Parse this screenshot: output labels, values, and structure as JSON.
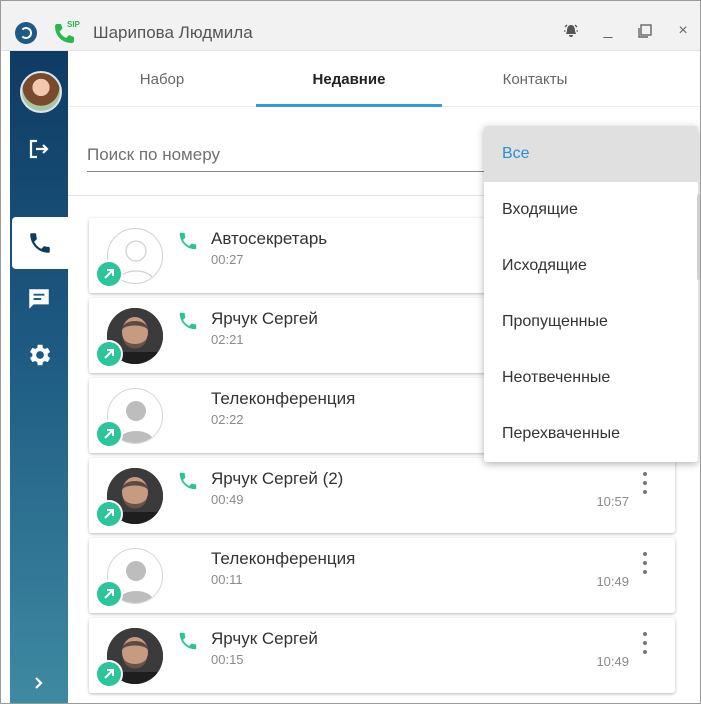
{
  "window": {
    "title": "Шарипова Людмила",
    "sip_label": "SIP",
    "buttons": {
      "minimize": "_",
      "close": "×"
    }
  },
  "sidebar": {
    "items": [
      {
        "icon": "avatar"
      },
      {
        "icon": "logout-icon"
      },
      {
        "icon": "phone-icon",
        "active": true
      },
      {
        "icon": "chat-icon"
      },
      {
        "icon": "gear-icon"
      },
      {
        "icon": "chevron-right-icon"
      }
    ]
  },
  "tabs": [
    {
      "label": "Набор"
    },
    {
      "label": "Недавние",
      "active": true
    },
    {
      "label": "Контакты"
    }
  ],
  "search": {
    "placeholder": "Поиск по номеру",
    "value": ""
  },
  "calls": [
    {
      "name": "Автосекретарь",
      "duration": "00:27",
      "time": "",
      "avatar": "blank",
      "phone": true
    },
    {
      "name": "Ярчук Сергей",
      "duration": "02:21",
      "time": "",
      "avatar": "photo",
      "phone": true
    },
    {
      "name": "Телеконференция",
      "duration": "02:22",
      "time": "",
      "avatar": "grey",
      "phone": false
    },
    {
      "name": "Ярчук Сергей (2)",
      "duration": "00:49",
      "time": "10:57",
      "avatar": "photo",
      "phone": true
    },
    {
      "name": "Телеконференция",
      "duration": "00:11",
      "time": "10:49",
      "avatar": "grey",
      "phone": false
    },
    {
      "name": "Ярчук Сергей",
      "duration": "00:15",
      "time": "10:49",
      "avatar": "photo",
      "phone": true
    }
  ],
  "filter_dropdown": {
    "options": [
      "Все",
      "Входящие",
      "Исходящие",
      "Пропущенные",
      "Неотвеченные",
      "Перехваченные"
    ],
    "selected": "Все"
  },
  "colors": {
    "accent": "#3a9ad9",
    "badge": "#2cc49a",
    "phone": "#2cc49a",
    "sidebar": "#0f3b63"
  }
}
